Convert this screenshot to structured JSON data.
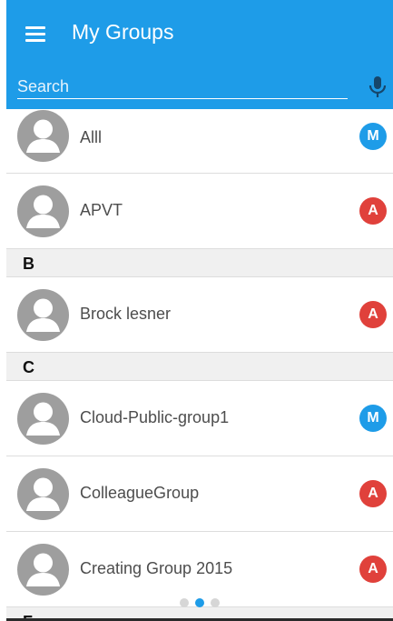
{
  "header": {
    "title": "My Groups",
    "menu_icon": "hamburger-menu-icon"
  },
  "search": {
    "placeholder": "Search",
    "value": "",
    "mic_icon": "microphone-icon"
  },
  "colors": {
    "primary": "#1e9ce8",
    "badge_m": "#1e9ce8",
    "badge_a": "#e0413b",
    "section_bg": "#f0f0f0"
  },
  "groups": [
    {
      "name": "Alll",
      "badge": "M"
    },
    {
      "name": "APVT",
      "badge": "A"
    },
    {
      "section": "B"
    },
    {
      "name": "Brock lesner",
      "badge": "A"
    },
    {
      "section": "C"
    },
    {
      "name": "Cloud-Public-group1",
      "badge": "M"
    },
    {
      "name": "ColleagueGroup",
      "badge": "A"
    },
    {
      "name": "Creating Group 2015",
      "badge": "A"
    },
    {
      "section": "F"
    }
  ],
  "pager": {
    "pages": 3,
    "active": 2
  }
}
